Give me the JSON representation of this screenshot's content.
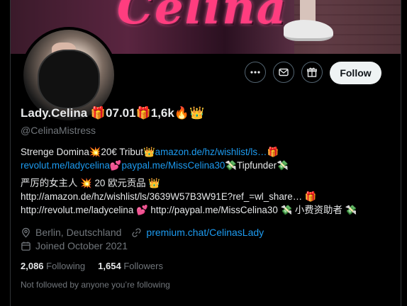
{
  "banner": {
    "text": "Celina"
  },
  "actions": {
    "more_icon": "more-dots-icon",
    "message_icon": "mail-icon",
    "gift_icon": "gift-icon",
    "follow_label": "Follow"
  },
  "profile": {
    "display_name": "Lady.Celina 🎁07.01🎁1,6k🔥👑",
    "handle": "@CelinaMistress"
  },
  "bio": {
    "l1_text": "Strenge Domina💥20€ Tribut👑",
    "l1_link": "amazon.de/hz/wishlist/ls…",
    "l1_end": "🎁",
    "l2_link1": "revolut.me/ladycelina",
    "l2_mid": "💕",
    "l2_link2": "paypal.me/MissCelina30",
    "l2_end": "💸Tipfunder💸",
    "l3": "严厉的女主人 💥 20 欧元贡品 👑",
    "l4": "http://amazon.de/hz/wishlist/ls/3639W57B3W91E?ref_=wl_share… 🎁",
    "l5": "http://revolut.me/ladycelina 💕 http://paypal.me/MissCelina30 💸 小费资助者 💸"
  },
  "meta": {
    "location": "Berlin, Deutschland",
    "website": "premium.chat/CelinasLady",
    "joined": "Joined October 2021"
  },
  "counts": {
    "following_num": "2,086",
    "following_label": "Following",
    "followers_num": "1,654",
    "followers_label": "Followers"
  },
  "not_followed": "Not followed by anyone you’re following"
}
